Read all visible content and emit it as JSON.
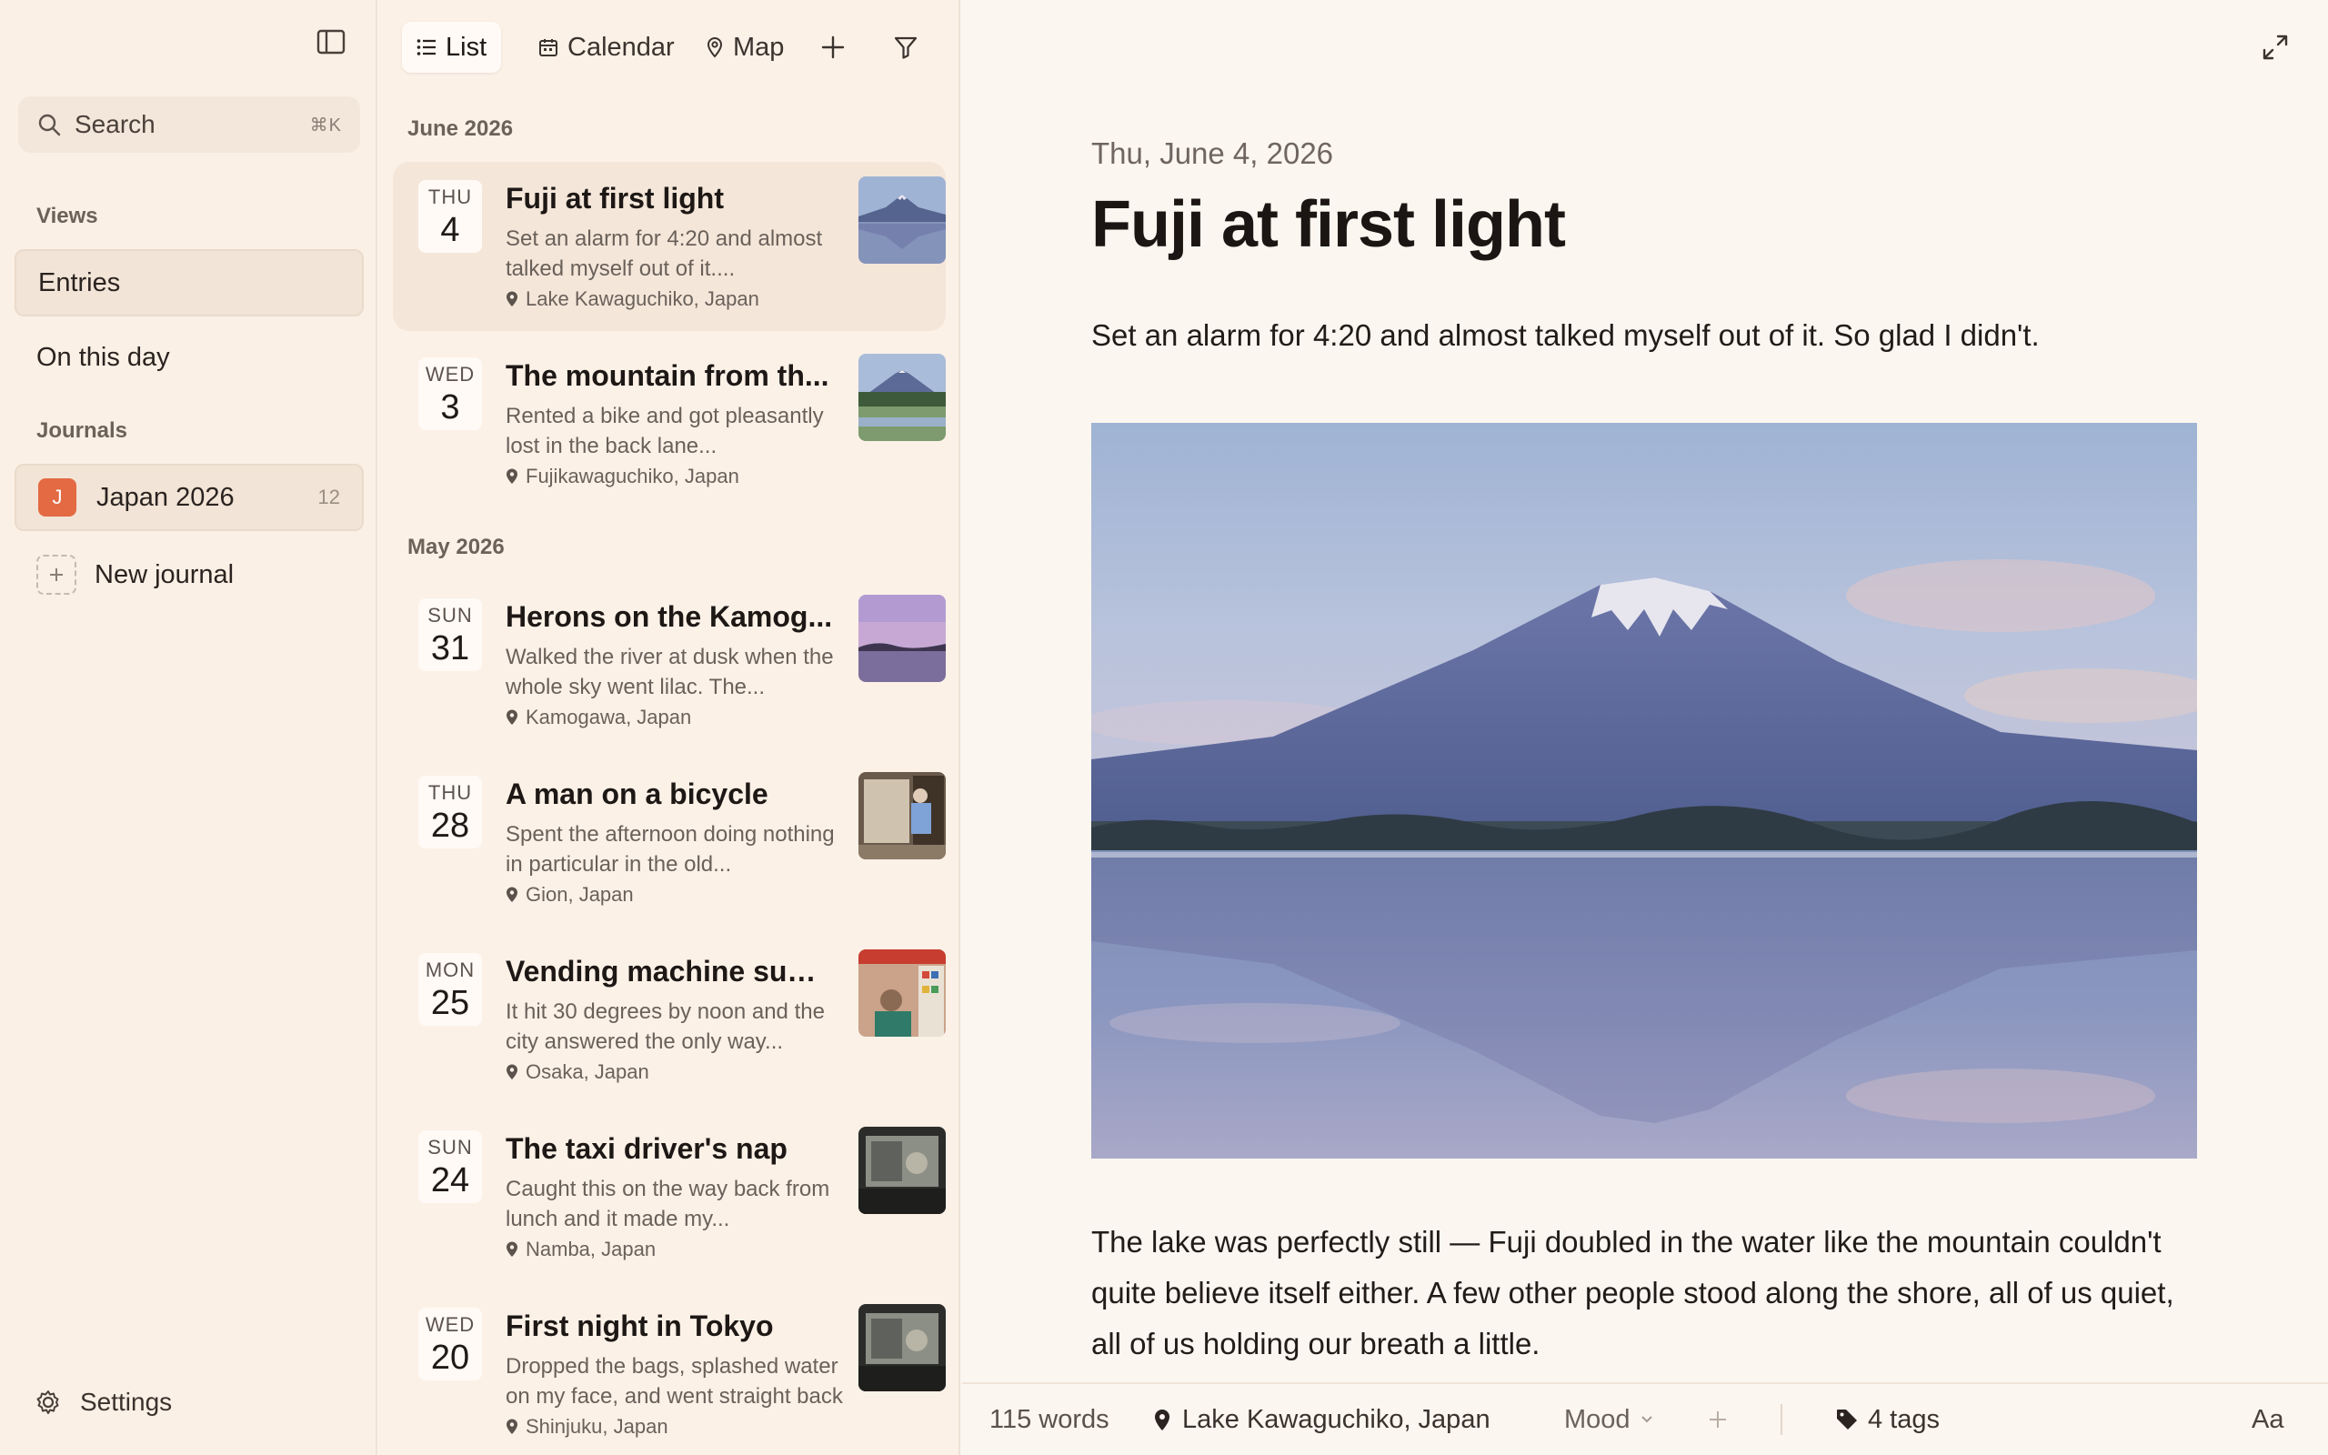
{
  "sidebar": {
    "search_label": "Search",
    "search_shortcut": "⌘K",
    "views_heading": "Views",
    "views": [
      {
        "label": "Entries",
        "active": true
      },
      {
        "label": "On this day",
        "active": false
      }
    ],
    "journals_heading": "Journals",
    "journals": [
      {
        "initial": "J",
        "name": "Japan 2026",
        "count": "12",
        "color": "#e36a43"
      }
    ],
    "new_journal_label": "New journal",
    "settings_label": "Settings"
  },
  "list": {
    "tabs": [
      {
        "label": "List",
        "icon": "list-icon",
        "active": true
      },
      {
        "label": "Calendar",
        "icon": "calendar-icon",
        "active": false
      },
      {
        "label": "Map",
        "icon": "map-pin-icon",
        "active": false
      }
    ],
    "groups": [
      {
        "month": "June 2026",
        "entries": [
          {
            "dow": "THU",
            "day": "4",
            "title": "Fuji at first light",
            "snippet": "Set an alarm for 4:20 and almost talked myself out of it....",
            "location": "Lake Kawaguchiko, Japan",
            "selected": true
          },
          {
            "dow": "WED",
            "day": "3",
            "title": "The mountain from th...",
            "snippet": "Rented a bike and got pleasantly lost in the back lane...",
            "location": "Fujikawaguchiko, Japan",
            "selected": false
          }
        ]
      },
      {
        "month": "May 2026",
        "entries": [
          {
            "dow": "SUN",
            "day": "31",
            "title": "Herons on the Kamog...",
            "snippet": "Walked the river at dusk when the whole sky went lilac. The...",
            "location": "Kamogawa, Japan",
            "selected": false
          },
          {
            "dow": "THU",
            "day": "28",
            "title": "A man on a bicycle",
            "snippet": "Spent the afternoon doing nothing in particular in the old...",
            "location": "Gion, Japan",
            "selected": false
          },
          {
            "dow": "MON",
            "day": "25",
            "title": "Vending machine sum...",
            "snippet": "It hit 30 degrees by noon and the city answered the only way...",
            "location": "Osaka, Japan",
            "selected": false
          },
          {
            "dow": "SUN",
            "day": "24",
            "title": "The taxi driver's nap",
            "snippet": "Caught this on the way back from lunch and it made my...",
            "location": "Namba, Japan",
            "selected": false
          },
          {
            "dow": "WED",
            "day": "20",
            "title": "First night in Tokyo",
            "snippet": "Dropped the bags, splashed water on my face, and went straight back out — too...",
            "location": "Shinjuku, Japan",
            "selected": false
          }
        ]
      }
    ]
  },
  "detail": {
    "date": "Thu, June 4, 2026",
    "title": "Fuji at first light",
    "lead": "Set an alarm for 4:20 and almost talked myself out of it. So glad I didn't.",
    "body": "The lake was perfectly still — Fuji doubled in the water like the mountain couldn't quite believe itself either. A few other people stood along the shore, all of us quiet, all of us holding our breath a little."
  },
  "status": {
    "words": "115 words",
    "location": "Lake Kawaguchiko, Japan",
    "mood": "Mood",
    "tags": "4 tags",
    "font_toggle": "Aa"
  },
  "colors": {
    "accent": "#e36a43",
    "sidebar_bg": "#fbf0e5",
    "selected_bg": "#f4e6d9"
  }
}
